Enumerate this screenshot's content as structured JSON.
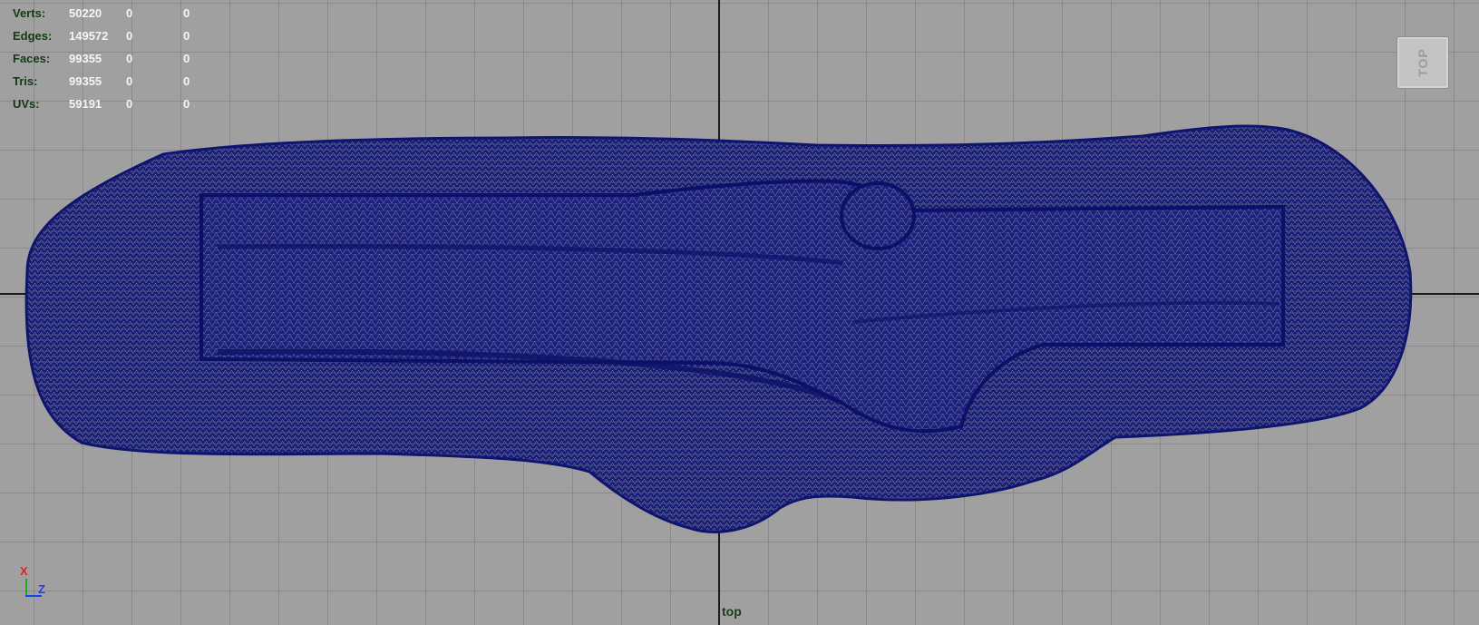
{
  "stats": [
    {
      "label": "Verts:",
      "v1": "50220",
      "v2": "0",
      "v3": "0"
    },
    {
      "label": "Edges:",
      "v1": "149572",
      "v2": "0",
      "v3": "0"
    },
    {
      "label": "Faces:",
      "v1": "99355",
      "v2": "0",
      "v3": "0"
    },
    {
      "label": "Tris:",
      "v1": "99355",
      "v2": "0",
      "v3": "0"
    },
    {
      "label": "UVs:",
      "v1": "59191",
      "v2": "0",
      "v3": "0"
    }
  ],
  "viewcube": {
    "label": "TOP"
  },
  "camera": {
    "name": "top"
  },
  "axis_gizmo": {
    "x_label": "X",
    "z_label": "Z"
  },
  "colors": {
    "background": "#a0a0a0",
    "grid": "#8a8a8a",
    "wireframe": "#141a7a",
    "hud_label": "#123c12",
    "hud_value": "#f4f4f4"
  }
}
